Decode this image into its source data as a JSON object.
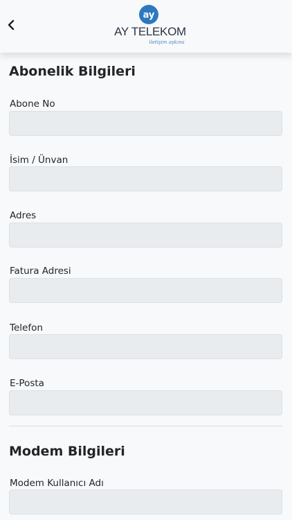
{
  "header": {
    "back_icon": "chevron-left-icon",
    "logo_mark": "ay",
    "logo_name": "AY TELEKOM",
    "logo_tagline": "iletişim aşkına",
    "brand_color": "#2c79c0"
  },
  "subscriber": {
    "title": "Abonelik Bilgileri",
    "subscriber_no": {
      "label": "Abone No",
      "value": ""
    },
    "name": {
      "label": "İsim / Ünvan",
      "value": ""
    },
    "address": {
      "label": "Adres",
      "value": ""
    },
    "billing_address": {
      "label": "Fatura Adresi",
      "value": ""
    },
    "phone": {
      "label": "Telefon",
      "value": ""
    },
    "email": {
      "label": "E-Posta",
      "value": ""
    }
  },
  "modem": {
    "title": "Modem Bilgileri",
    "username": {
      "label": "Modem Kullanıcı Adı",
      "value": ""
    }
  }
}
